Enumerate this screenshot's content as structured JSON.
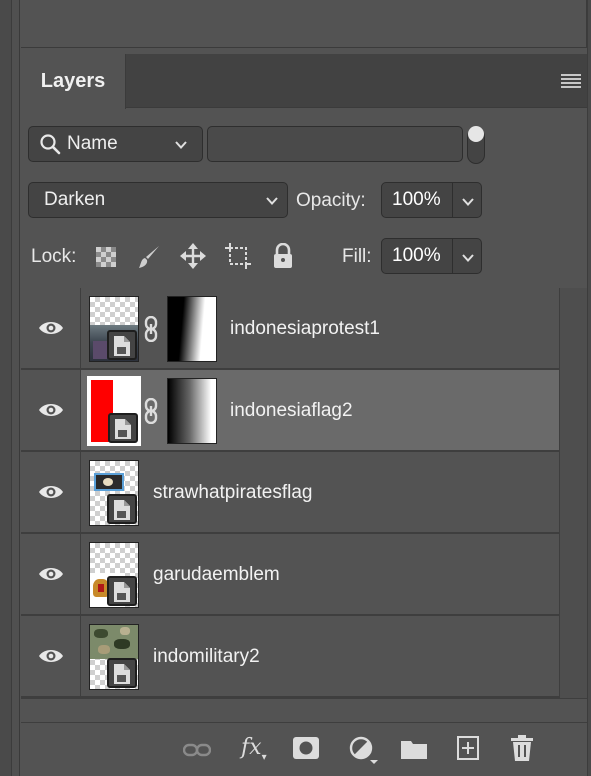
{
  "panel": {
    "tab_label": "Layers",
    "menu_icon": "panel-menu-icon"
  },
  "filter": {
    "kind_label": "Name",
    "search_value": ""
  },
  "blend": {
    "mode": "Darken",
    "opacity_label": "Opacity:",
    "opacity_value": "100%"
  },
  "lock": {
    "label": "Lock:",
    "fill_label": "Fill:",
    "fill_value": "100%"
  },
  "layers": [
    {
      "name": "indonesiaprotest1",
      "visible": true,
      "has_mask": true,
      "selected": false
    },
    {
      "name": "indonesiaflag2",
      "visible": true,
      "has_mask": true,
      "selected": true
    },
    {
      "name": "strawhatpiratesflag",
      "visible": true,
      "has_mask": false,
      "selected": false
    },
    {
      "name": "garudaemblem",
      "visible": true,
      "has_mask": false,
      "selected": false
    },
    {
      "name": "indomilitary2",
      "visible": true,
      "has_mask": false,
      "selected": false
    }
  ],
  "footer_icons": [
    "link-layers-icon",
    "fx-icon",
    "add-mask-icon",
    "adjustment-layer-icon",
    "new-group-icon",
    "new-layer-icon",
    "delete-layer-icon"
  ],
  "footer_fx_label": "fx",
  "colors": {
    "panel_bg": "#535353",
    "selected_row": "#6a6a6a",
    "flag_red": "#ff0000"
  }
}
